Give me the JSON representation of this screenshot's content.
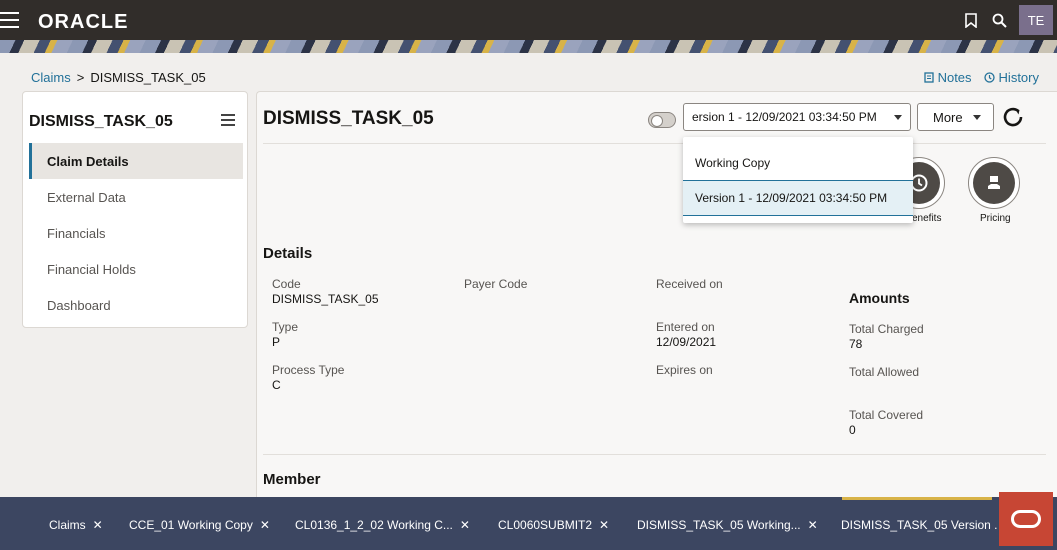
{
  "header": {
    "logo_text": "ORACLE",
    "avatar_initials": "TE"
  },
  "breadcrumb": {
    "parent": "Claims",
    "separator": ">",
    "current": "DISMISS_TASK_05"
  },
  "top_links": {
    "notes": "Notes",
    "history": "History"
  },
  "left_panel": {
    "title": "DISMISS_TASK_05",
    "items": [
      {
        "label": "Claim Details",
        "active": true
      },
      {
        "label": "External Data",
        "active": false
      },
      {
        "label": "Financials",
        "active": false
      },
      {
        "label": "Financial Holds",
        "active": false
      },
      {
        "label": "Dashboard",
        "active": false
      }
    ]
  },
  "main": {
    "title": "DISMISS_TASK_05",
    "version_select": "ersion 1 - 12/09/2021 03:34:50 PM",
    "more_label": "More",
    "circle_buttons": {
      "benefits_label": "enefits",
      "pricing_label": "Pricing"
    },
    "details": {
      "title": "Details",
      "code_label": "Code",
      "code_value": "DISMISS_TASK_05",
      "payer_code_label": "Payer Code",
      "received_label": "Received on",
      "type_label": "Type",
      "type_value": "P",
      "entered_label": "Entered on",
      "entered_value": "12/09/2021",
      "process_type_label": "Process Type",
      "process_type_value": "C",
      "expires_label": "Expires on"
    },
    "amounts": {
      "title": "Amounts",
      "charged_label": "Total Charged",
      "charged_value": "78",
      "allowed_label": "Total Allowed",
      "covered_label": "Total Covered",
      "covered_value": "0"
    },
    "member_title": "Member"
  },
  "dropdown": {
    "options": [
      {
        "label": "Working Copy",
        "selected": false
      },
      {
        "label": "Version 1 - 12/09/2021 03:34:50 PM",
        "selected": true
      }
    ]
  },
  "taskbar": {
    "tabs": [
      {
        "label": "Claims"
      },
      {
        "label": "CCE_01 Working Copy"
      },
      {
        "label": "CL0136_1_2_02 Working C..."
      },
      {
        "label": "CL0060SUBMIT2"
      },
      {
        "label": "DISMISS_TASK_05 Working..."
      },
      {
        "label": "DISMISS_TASK_05 Version ."
      }
    ],
    "close_glyph": "✕"
  },
  "colors": {
    "header_bg": "#312d2a",
    "taskbar_bg": "#3c4661",
    "link": "#227199",
    "accent_gold": "#d8b348",
    "chat_button": "#c74634"
  }
}
